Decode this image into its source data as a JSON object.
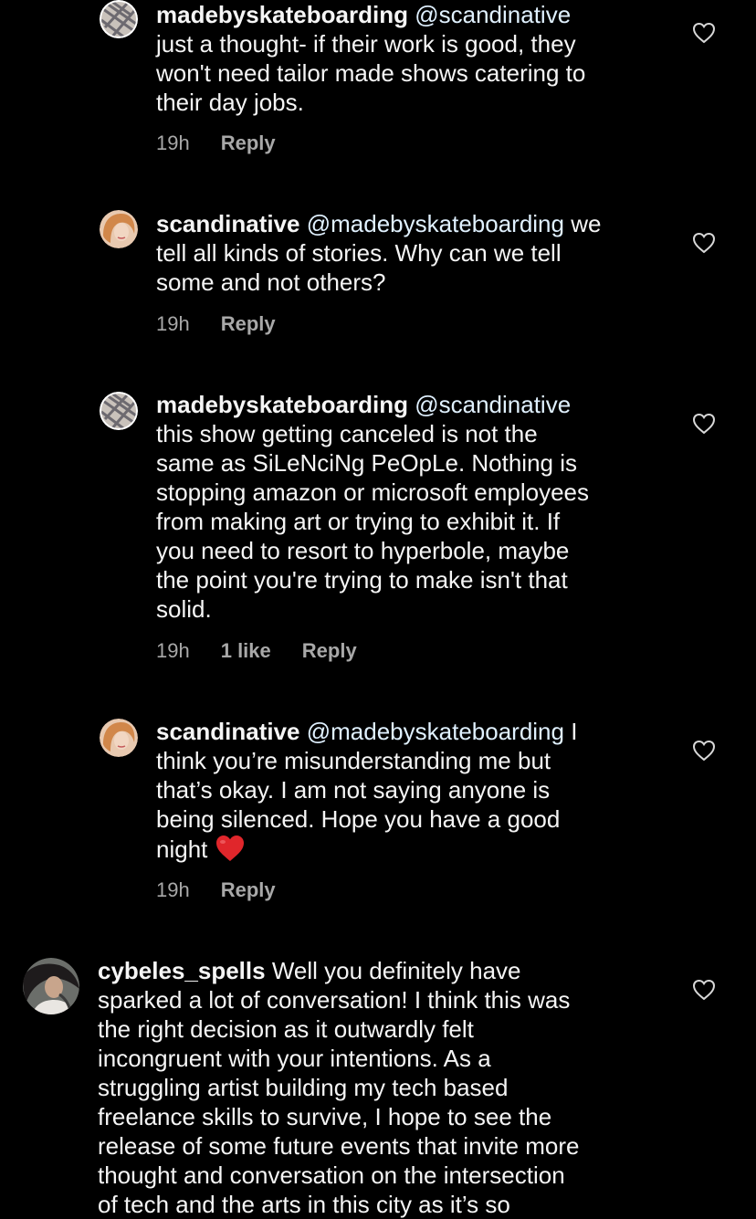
{
  "comments": [
    {
      "username": "madebyskateboarding",
      "mention": "@scandinative",
      "lines": [
        "just a thought- if their work is good, they",
        "won't need tailor made shows catering to",
        "their day jobs."
      ],
      "time": "19h",
      "reply_label": "Reply"
    },
    {
      "username": "scandinative",
      "mention": "@madebyskateboarding",
      "first_line_tail": "we",
      "lines": [
        "tell all kinds of stories. Why can we tell",
        "some and not others?"
      ],
      "time": "19h",
      "reply_label": "Reply"
    },
    {
      "username": "madebyskateboarding",
      "mention": "@scandinative",
      "lines": [
        "this show getting canceled is not the",
        "same as SiLeNciNg PeOpLe. Nothing is",
        "stopping amazon or microsoft employees",
        "from making art or trying to exhibit it.  If",
        "you need to resort to hyperbole, maybe",
        "the point you're trying to make isn't that",
        "solid."
      ],
      "time": "19h",
      "likes": "1 like",
      "reply_label": "Reply"
    },
    {
      "username": "scandinative",
      "mention": "@madebyskateboarding",
      "first_line_tail": "I",
      "lines": [
        "think you’re misunderstanding me but",
        "that’s okay. I am not saying anyone is",
        "being silenced. Hope you have a good",
        "night"
      ],
      "emoji": "❤️",
      "time": "19h",
      "reply_label": "Reply"
    },
    {
      "username": "cybeles_spells",
      "first_line_tail": "Well you definitely have",
      "lines": [
        "sparked a lot of conversation! I think this was",
        "the right decision as it outwardly felt",
        "incongruent with your intentions. As a",
        "struggling artist building my tech based",
        "freelance skills to survive, I hope to see the",
        "release of some future events that invite more",
        "thought and conversation on the intersection",
        "of tech and the arts in this city as it’s so"
      ]
    }
  ],
  "icons": {
    "heart": "heart-outline-icon",
    "emoji": "red-heart-emoji"
  },
  "colors": {
    "background": "#000000",
    "text": "#f5f5f5",
    "meta": "#a8a8a8",
    "emoji_red": "#e0262b"
  }
}
